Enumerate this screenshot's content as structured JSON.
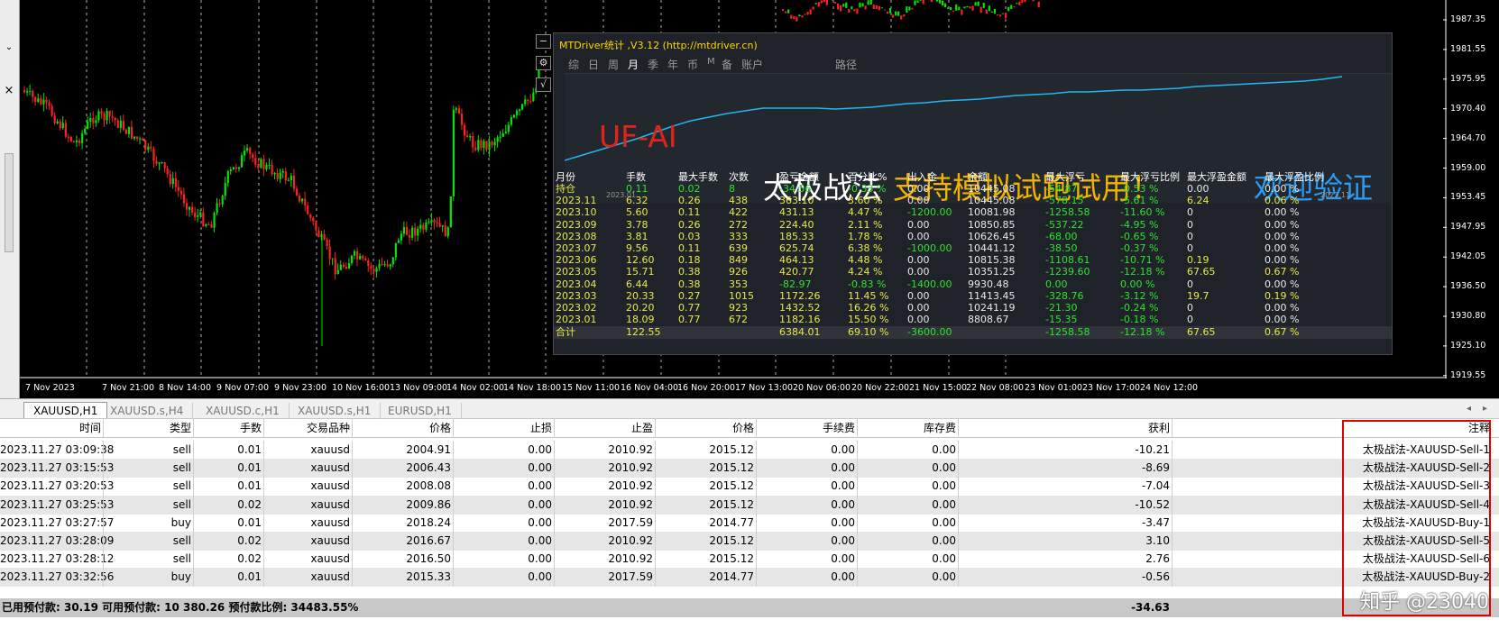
{
  "price_ticks": [
    "1987.35",
    "1981.55",
    "1975.95",
    "1970.40",
    "1964.70",
    "1959.00",
    "1953.45",
    "1947.95",
    "1942.05",
    "1936.50",
    "1930.80",
    "1925.10",
    "1919.55"
  ],
  "time_ticks": [
    "7 Nov 2023",
    "7 Nov 21:00",
    "8 Nov 14:00",
    "9 Nov 07:00",
    "9 Nov 23:00",
    "10 Nov 16:00",
    "13 Nov 09:00",
    "14 Nov 02:00",
    "14 Nov 18:00",
    "15 Nov 11:00",
    "16 Nov 04:00",
    "16 Nov 20:00",
    "17 Nov 13:00",
    "20 Nov 06:00",
    "20 Nov 22:00",
    "21 Nov 15:00",
    "22 Nov 08:00",
    "23 Nov 01:00",
    "23 Nov 17:00",
    "24 Nov 12:00"
  ],
  "colors": {
    "bull": "#00e600",
    "bear": "#ff2020",
    "equity": "#22b7f0",
    "yellow": "#e8e84a",
    "green": "#2ee22e",
    "highlight": "#e00000"
  },
  "side_buttons": {
    "minimize": "−",
    "settings": "⚙",
    "check": "√"
  },
  "left_strip": {
    "scroll_down": "⌄",
    "close": "×"
  },
  "panel": {
    "title": "MTDriver统计 ,V3.12 (http://mtdriver.cn)",
    "tabs": [
      "综",
      "日",
      "周",
      "月",
      "季",
      "年",
      "币",
      "M",
      "备",
      "账户",
      "路径"
    ],
    "active_tab": "月",
    "equity_start_label": "2023.01",
    "equity_end_label": "2023.11",
    "watermark": "UF-AI",
    "promo_white": "太极战法",
    "promo_yellow": "支持模拟试跑试用！",
    "promo_blue": "欢迎验证",
    "headers": [
      "月份",
      "手数",
      "最大手数",
      "次数",
      "盈亏金额",
      "百分比%",
      "出入金",
      "余额",
      "最大浮亏",
      "最大浮亏比例",
      "最大浮盈金额",
      "最大浮盈比例"
    ],
    "rows": [
      [
        "持仓",
        "0.11",
        "0.02",
        "8",
        "-34.56",
        "-0.33 %",
        "0.00",
        "10445.08",
        "-54.87",
        "-0.53 %",
        "0.00",
        "0.00 %"
      ],
      [
        "2023.11",
        "6.32",
        "0.26",
        "438",
        "363.10",
        "3.60 %",
        "0.00",
        "10445.08",
        "-578.15",
        "-5.61 %",
        "6.24",
        "0.06 %"
      ],
      [
        "2023.10",
        "5.60",
        "0.11",
        "422",
        "431.13",
        "4.47 %",
        "-1200.00",
        "10081.98",
        "-1258.58",
        "-11.60 %",
        "0",
        "0.00 %"
      ],
      [
        "2023.09",
        "3.78",
        "0.26",
        "272",
        "224.40",
        "2.11 %",
        "0.00",
        "10850.85",
        "-537.22",
        "-4.95 %",
        "0",
        "0.00 %"
      ],
      [
        "2023.08",
        "3.81",
        "0.03",
        "333",
        "185.33",
        "1.78 %",
        "0.00",
        "10626.45",
        "-68.00",
        "-0.65 %",
        "0",
        "0.00 %"
      ],
      [
        "2023.07",
        "9.56",
        "0.11",
        "639",
        "625.74",
        "6.38 %",
        "-1000.00",
        "10441.12",
        "-38.50",
        "-0.37 %",
        "0",
        "0.00 %"
      ],
      [
        "2023.06",
        "12.60",
        "0.18",
        "849",
        "464.13",
        "4.48 %",
        "0.00",
        "10815.38",
        "-1108.61",
        "-10.71 %",
        "0.19",
        "0.00 %"
      ],
      [
        "2023.05",
        "15.71",
        "0.38",
        "926",
        "420.77",
        "4.24 %",
        "0.00",
        "10351.25",
        "-1239.60",
        "-12.18 %",
        "67.65",
        "0.67 %"
      ],
      [
        "2023.04",
        "6.44",
        "0.38",
        "353",
        "-82.97",
        "-0.83 %",
        "-1400.00",
        "9930.48",
        "0.00",
        "0.00 %",
        "0",
        "0.00 %"
      ],
      [
        "2023.03",
        "20.33",
        "0.27",
        "1015",
        "1172.26",
        "11.45 %",
        "0.00",
        "11413.45",
        "-328.76",
        "-3.12 %",
        "19.7",
        "0.19 %"
      ],
      [
        "2023.02",
        "20.20",
        "0.77",
        "923",
        "1432.52",
        "16.26 %",
        "0.00",
        "10241.19",
        "-21.30",
        "-0.24 %",
        "0",
        "0.00 %"
      ],
      [
        "2023.01",
        "18.09",
        "0.77",
        "672",
        "1182.16",
        "15.50 %",
        "0.00",
        "8808.67",
        "-15.35",
        "-0.18 %",
        "0",
        "0.00 %"
      ]
    ],
    "total": [
      "合计",
      "122.55",
      "",
      "",
      "6384.01",
      "69.10 %",
      "-3600.00",
      "",
      "-1258.58",
      "-12.18 %",
      "67.65",
      "0.67 %"
    ]
  },
  "symbol_tabs": [
    "XAUUSD,H1",
    "XAUUSD.s,H4",
    "XAUUSD.c,H1",
    "XAUUSD.s,H1",
    "EURUSD,H1"
  ],
  "tab_nav": {
    "prev": "◂",
    "next": "▸"
  },
  "orders": {
    "headers": [
      "时间",
      "类型",
      "手数",
      "交易品种",
      "价格",
      "止损",
      "止盈",
      "价格",
      "手续费",
      "库存费",
      "获利",
      "注释"
    ],
    "rows": [
      [
        "2023.11.27 03:09:38",
        "sell",
        "0.01",
        "xauusd",
        "2004.91",
        "0.00",
        "2010.92",
        "2015.12",
        "0.00",
        "0.00",
        "-10.21",
        "太极战法-XAUUSD-Sell-1"
      ],
      [
        "2023.11.27 03:15:53",
        "sell",
        "0.01",
        "xauusd",
        "2006.43",
        "0.00",
        "2010.92",
        "2015.12",
        "0.00",
        "0.00",
        "-8.69",
        "太极战法-XAUUSD-Sell-2"
      ],
      [
        "2023.11.27 03:20:53",
        "sell",
        "0.01",
        "xauusd",
        "2008.08",
        "0.00",
        "2010.92",
        "2015.12",
        "0.00",
        "0.00",
        "-7.04",
        "太极战法-XAUUSD-Sell-3"
      ],
      [
        "2023.11.27 03:25:53",
        "sell",
        "0.02",
        "xauusd",
        "2009.86",
        "0.00",
        "2010.92",
        "2015.12",
        "0.00",
        "0.00",
        "-10.52",
        "太极战法-XAUUSD-Sell-4"
      ],
      [
        "2023.11.27 03:27:57",
        "buy",
        "0.01",
        "xauusd",
        "2018.24",
        "0.00",
        "2017.59",
        "2014.77",
        "0.00",
        "0.00",
        "-3.47",
        "太极战法-XAUUSD-Buy-1"
      ],
      [
        "2023.11.27 03:28:09",
        "sell",
        "0.02",
        "xauusd",
        "2016.67",
        "0.00",
        "2010.92",
        "2015.12",
        "0.00",
        "0.00",
        "3.10",
        "太极战法-XAUUSD-Sell-5"
      ],
      [
        "2023.11.27 03:28:12",
        "sell",
        "0.02",
        "xauusd",
        "2016.50",
        "0.00",
        "2010.92",
        "2015.12",
        "0.00",
        "0.00",
        "2.76",
        "太极战法-XAUUSD-Sell-6"
      ],
      [
        "2023.11.27 03:32:56",
        "buy",
        "0.01",
        "xauusd",
        "2015.33",
        "0.00",
        "2017.59",
        "2014.77",
        "0.00",
        "0.00",
        "-0.56",
        "太极战法-XAUUSD-Buy-2"
      ]
    ]
  },
  "summary": {
    "text": "已用预付款: 30.19   可用预付款: 10 380.26   预付款比例: 34483.55%",
    "total": "-34.63"
  },
  "credit": "知乎 @23040"
}
